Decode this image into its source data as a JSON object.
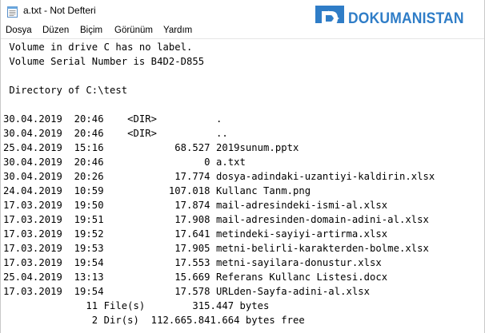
{
  "window": {
    "title": "a.txt - Not Defteri",
    "icon": "notepad-icon"
  },
  "menu": [
    "Dosya",
    "Düzen",
    "Biçim",
    "Görünüm",
    "Yardım"
  ],
  "watermark": {
    "text": "DOKUMANISTAN",
    "icon": "dokumanistan-logo-icon",
    "color": "#2f7dc7"
  },
  "content": {
    "lines": [
      " Volume in drive C has no label.",
      " Volume Serial Number is B4D2-D855",
      "",
      " Directory of C:\\test",
      "",
      "30.04.2019  20:46    <DIR>          .",
      "30.04.2019  20:46    <DIR>          ..",
      "25.04.2019  15:16            68.527 2019sunum.pptx",
      "30.04.2019  20:46                 0 a.txt",
      "30.04.2019  20:26            17.774 dosya-adindaki-uzantiyi-kaldirin.xlsx",
      "24.04.2019  10:59           107.018 Kullanc Tanm.png",
      "17.03.2019  19:50            17.874 mail-adresindeki-ismi-al.xlsx",
      "17.03.2019  19:51            17.908 mail-adresinden-domain-adini-al.xlsx",
      "17.03.2019  19:52            17.641 metindeki-sayiyi-artirma.xlsx",
      "17.03.2019  19:53            17.905 metni-belirli-karakterden-bolme.xlsx",
      "17.03.2019  19:54            17.553 metni-sayilara-donustur.xlsx",
      "25.04.2019  13:13            15.669 Referans Kullanc Listesi.docx",
      "17.03.2019  19:54            17.578 URLden-Sayfa-adini-al.xlsx",
      "              11 File(s)        315.447 bytes",
      "               2 Dir(s)  112.665.841.664 bytes free"
    ]
  }
}
